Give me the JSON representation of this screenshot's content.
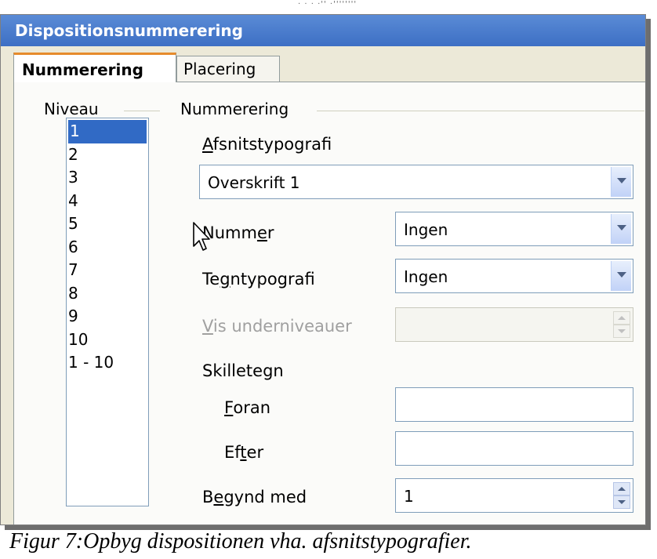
{
  "window": {
    "title": "Dispositionsnummerering"
  },
  "tabs": [
    {
      "label": "Nummerering",
      "active": true
    },
    {
      "label": "Placering",
      "active": false
    }
  ],
  "level_group": {
    "legend": "Niveau",
    "items": [
      "1",
      "2",
      "3",
      "4",
      "5",
      "6",
      "7",
      "8",
      "9",
      "10",
      "1 - 10"
    ],
    "selected": "1"
  },
  "numbering_group": {
    "legend": "Nummerering",
    "paragraph_style": {
      "label_mnemonic": "A",
      "label_rest": "fsnitstypografi",
      "value": "Overskrift 1"
    },
    "number": {
      "label_pre": "Numm",
      "label_mnemonic": "e",
      "label_post": "r",
      "value": "Ingen"
    },
    "char_style": {
      "label_pre": "Te",
      "label_mnemonic": "g",
      "label_post": "ntypografi",
      "value": "Ingen"
    },
    "sublevels": {
      "label_mnemonic": "V",
      "label_rest": "is underniveauer",
      "value": "",
      "disabled": true
    },
    "separator": {
      "label": "Skilletegn",
      "before": {
        "label_mnemonic": "F",
        "label_rest": "oran",
        "value": ""
      },
      "after": {
        "label_pre": "Ef",
        "label_mnemonic": "t",
        "label_post": "er",
        "value": ""
      }
    },
    "start_at": {
      "label_pre": "B",
      "label_mnemonic": "e",
      "label_post": "gynd med",
      "value": "1"
    }
  },
  "caption": "Figur 7:Opbyg dispositionen vha. afsnitstypografier.",
  "colors": {
    "titlebar": "#3d6fc4",
    "selection": "#316ac5",
    "dialog_bg": "#ece9d8",
    "tab_accent": "#e68b2c"
  },
  "icons": {
    "dropdown": "chevron-down-icon",
    "spinner": "spin-arrows-icon",
    "cursor": "mouse-pointer-icon"
  }
}
